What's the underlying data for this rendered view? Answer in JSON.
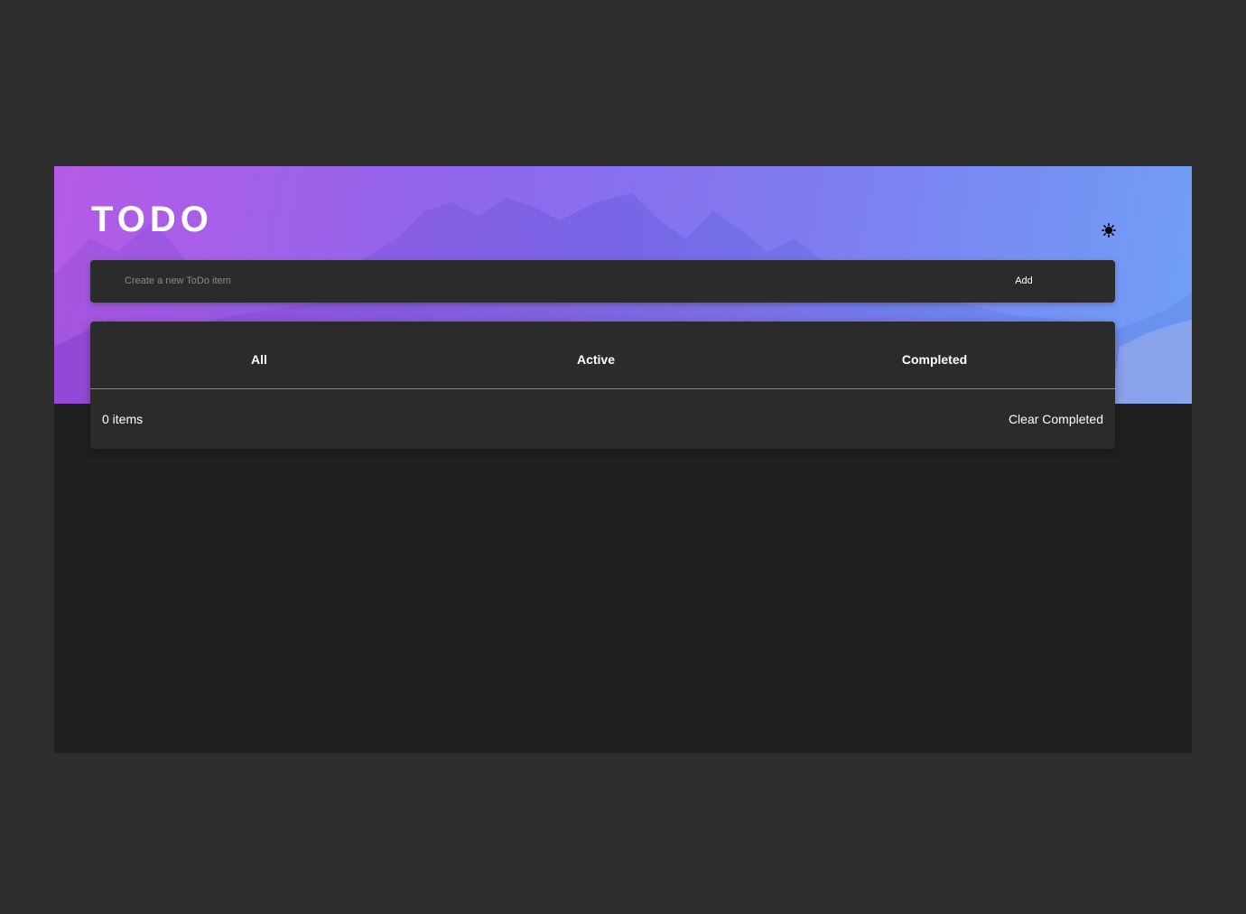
{
  "header": {
    "title": "TODO",
    "theme_toggle_icon": "sun-icon"
  },
  "new_todo": {
    "placeholder": "Create a new ToDo item",
    "value": "",
    "add_label": "Add"
  },
  "filters": {
    "tabs": [
      {
        "label": "All"
      },
      {
        "label": "Active"
      },
      {
        "label": "Completed"
      }
    ]
  },
  "footer": {
    "items_left": "0 items",
    "clear_label": "Clear Completed"
  },
  "colors": {
    "page_background": "#2e2e2e",
    "app_background": "#202020",
    "card_background": "#2b2b2b",
    "gradient_start": "#b55be6",
    "gradient_end": "#6fa0f6"
  }
}
